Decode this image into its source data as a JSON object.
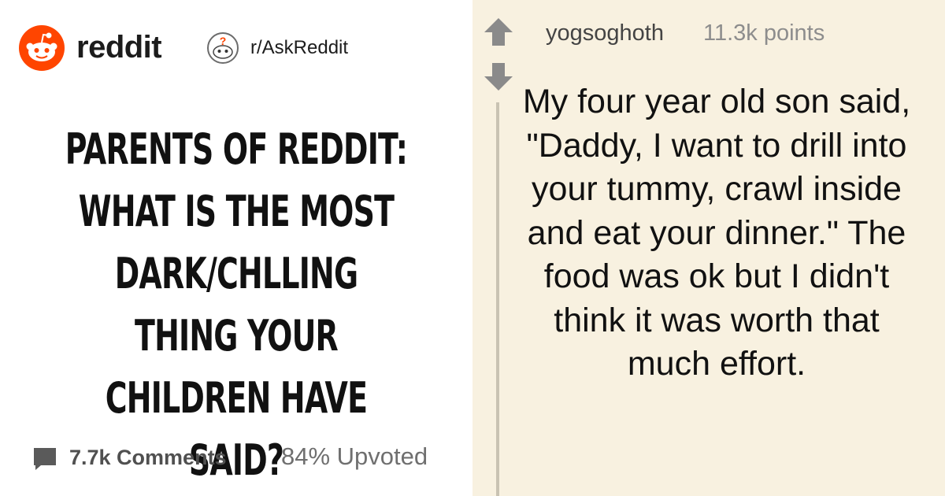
{
  "header": {
    "brand": "reddit",
    "subreddit": "r/AskReddit",
    "icons": [
      "reddit-logo-icon",
      "askreddit-icon"
    ]
  },
  "post": {
    "title": "PARENTS OF REDDIT: WHAT IS THE MOST DARK/CHLLING THING YOUR CHILDREN HAVE SAID?",
    "comments_label": "7.7k Comments",
    "upvoted_label": "84% Upvoted"
  },
  "comment": {
    "username": "yogsoghoth",
    "points": "11.3k points",
    "body": "My four year old son said, \"Daddy, I want to drill into your tummy, crawl inside and eat your dinner.\" The food was ok but I didn't think it was worth that much effort."
  },
  "colors": {
    "reddit_orange": "#ff4500",
    "right_panel_bg": "#f8f1e0",
    "vote_arrow": "#8a8a8a",
    "text_dark": "#111111",
    "stat_gray": "#505050"
  }
}
